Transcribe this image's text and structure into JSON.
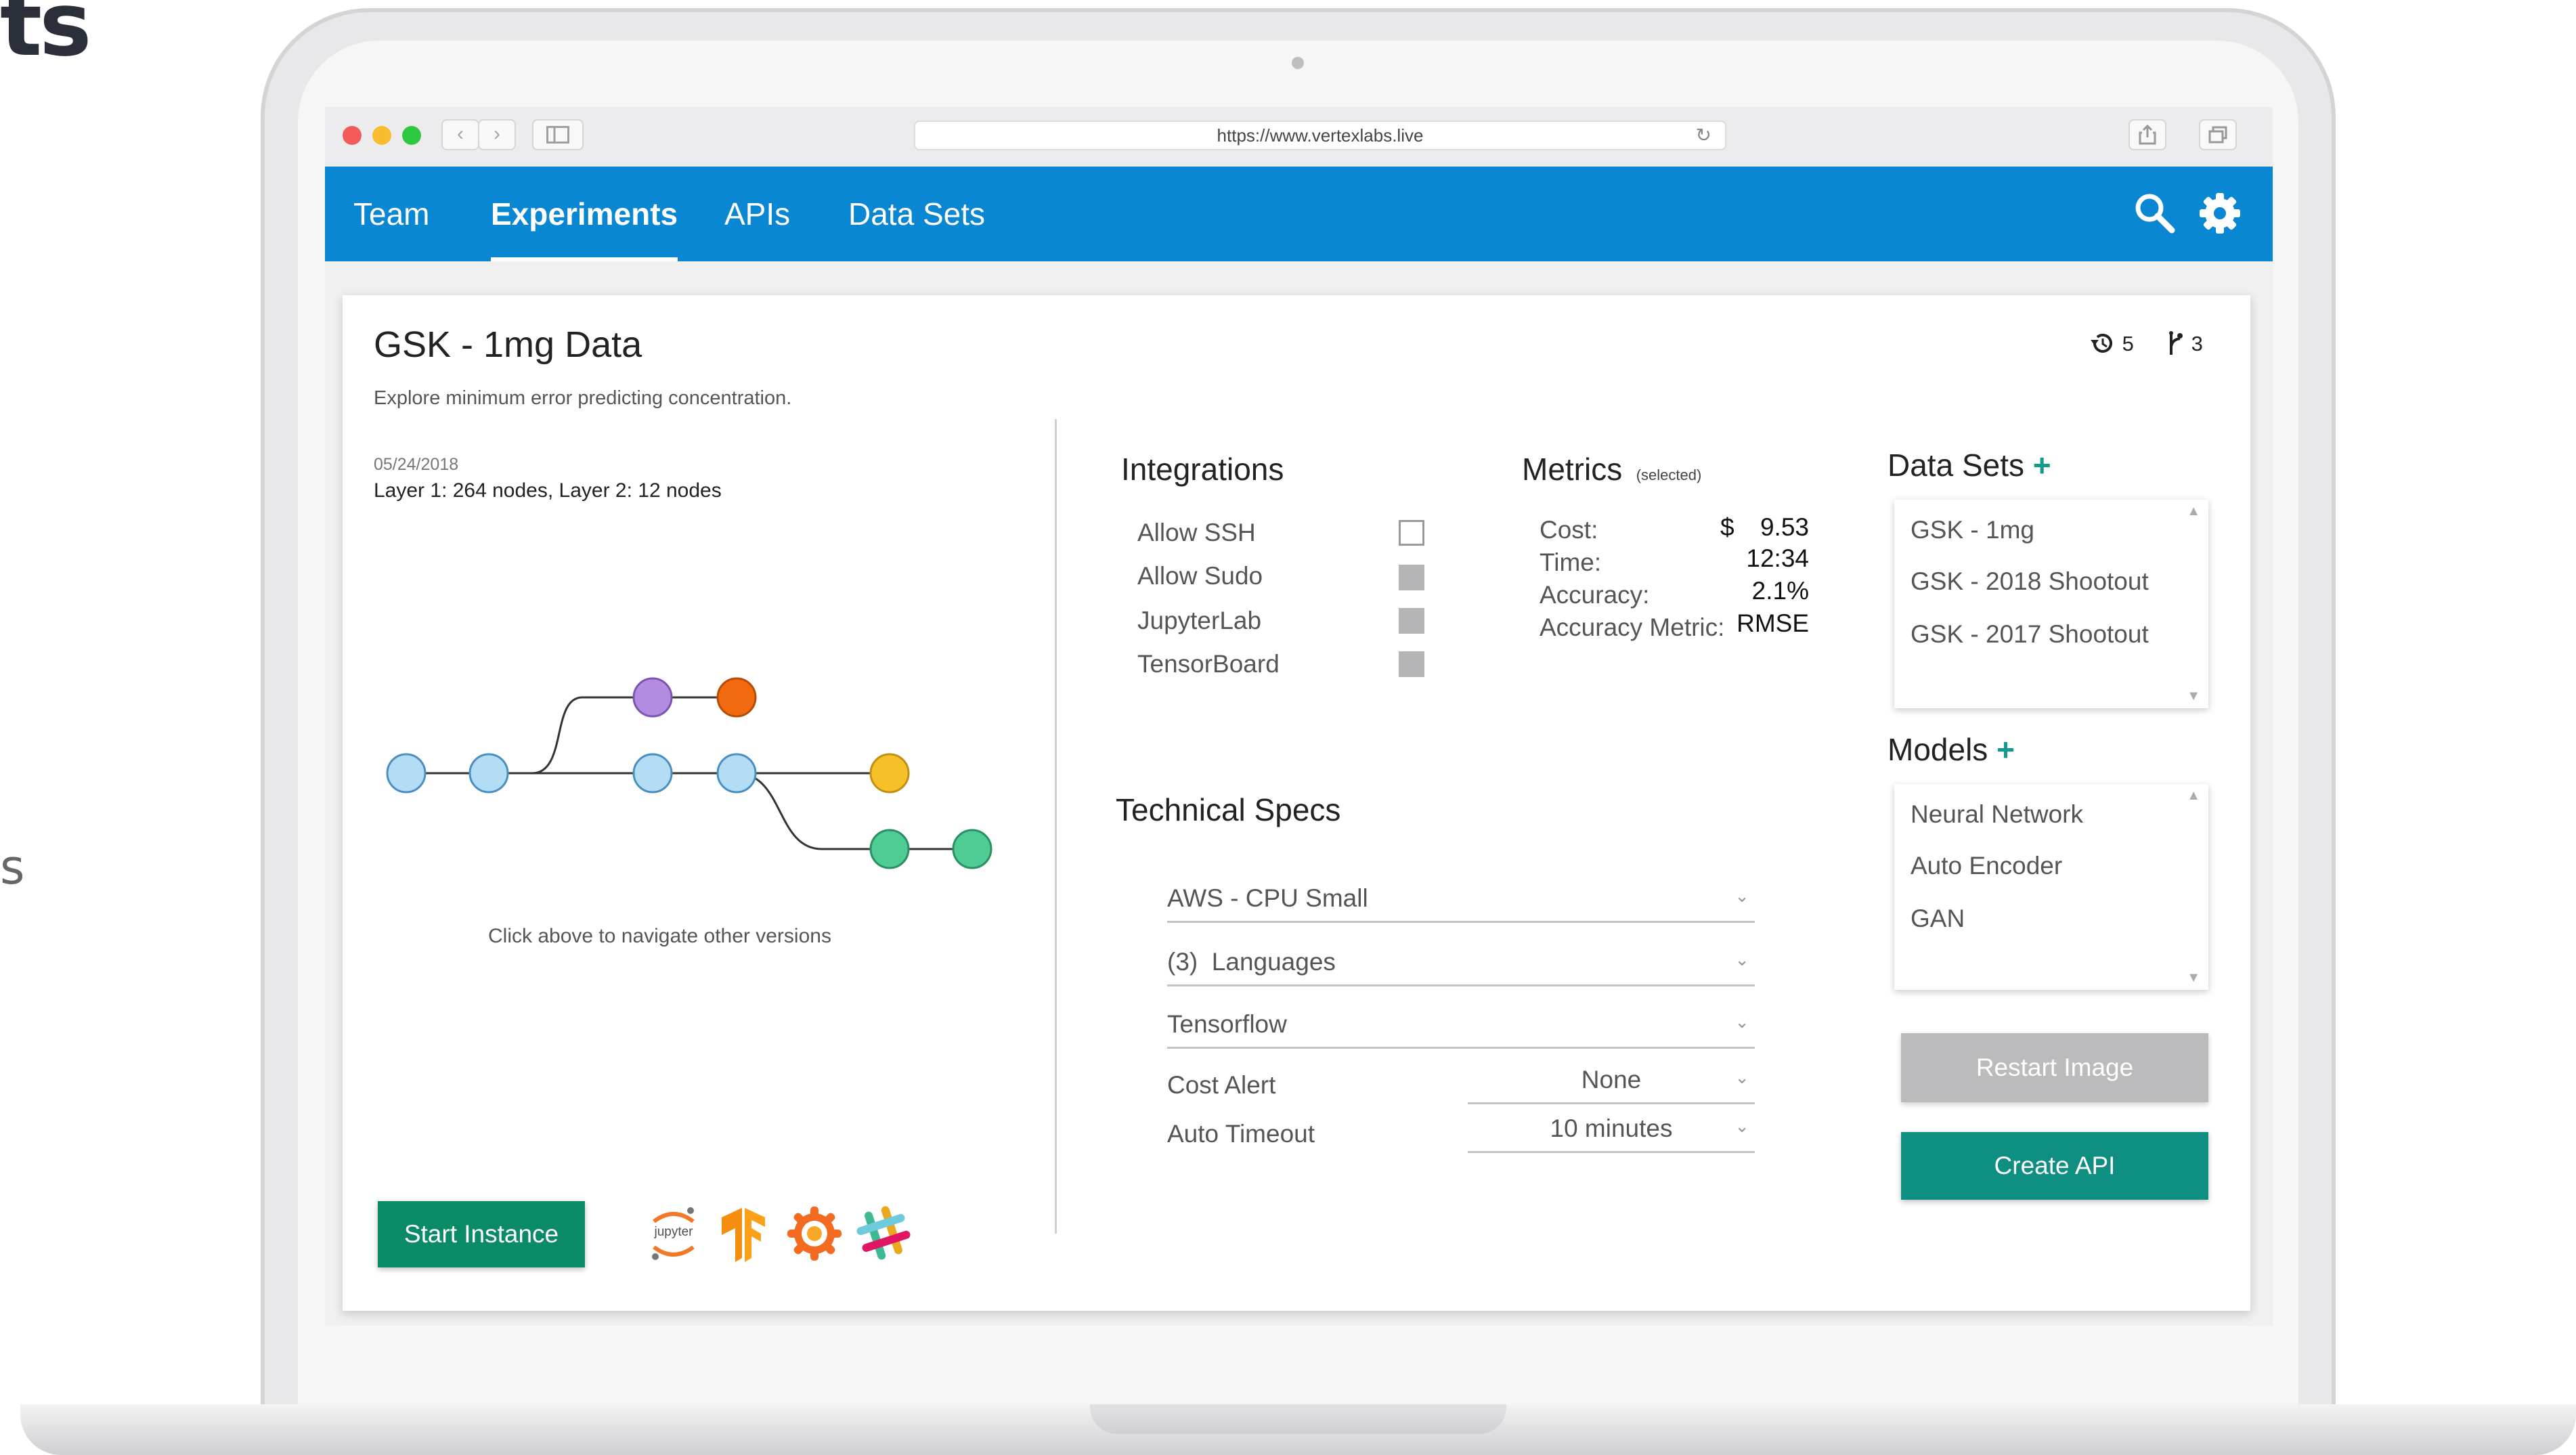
{
  "background": {
    "fragment_top": "ts",
    "fragment_mid": "s"
  },
  "browser": {
    "url": "https://www.vertexlabs.live",
    "back_glyph": "‹",
    "forward_glyph": "›"
  },
  "nav": {
    "tabs": [
      {
        "label": "Team",
        "active": false
      },
      {
        "label": "Experiments",
        "active": true
      },
      {
        "label": "APIs",
        "active": false
      },
      {
        "label": "Data Sets",
        "active": false
      }
    ],
    "icons": [
      "search-icon",
      "gear-icon"
    ]
  },
  "experiment": {
    "title": "GSK - 1mg Data",
    "subtitle": "Explore minimum error predicting concentration.",
    "date": "05/24/2018",
    "layers": "Layer 1: 264 nodes, Layer 2: 12 nodes",
    "history_count": "5",
    "branch_count": "3",
    "graph_hint": "Click above to navigate other versions"
  },
  "integrations": {
    "title": "Integrations",
    "items": [
      {
        "label": "Allow SSH",
        "checked": false
      },
      {
        "label": "Allow Sudo",
        "checked": true
      },
      {
        "label": "JupyterLab",
        "checked": true
      },
      {
        "label": "TensorBoard",
        "checked": true
      }
    ]
  },
  "metrics": {
    "title": "Metrics",
    "note": "(selected)",
    "rows": [
      {
        "label": "Cost:",
        "currency": "$",
        "value": "9.53"
      },
      {
        "label": "Time:",
        "value": "12:34"
      },
      {
        "label": "Accuracy:",
        "value": "2.1%"
      },
      {
        "label": "Accuracy Metric:",
        "value": "RMSE"
      }
    ]
  },
  "specs": {
    "title": "Technical Specs",
    "instance": "AWS - CPU Small",
    "languages_count": "(3)",
    "languages": "Languages",
    "framework": "Tensorflow",
    "cost_alert_label": "Cost Alert",
    "cost_alert_value": "None",
    "timeout_label": "Auto Timeout",
    "timeout_value": "10 minutes"
  },
  "datasets": {
    "title": "Data Sets",
    "plus": "+",
    "items": [
      "GSK - 1mg",
      "GSK - 2018 Shootout",
      "GSK - 2017 Shootout"
    ]
  },
  "models": {
    "title": "Models",
    "plus": "+",
    "items": [
      "Neural Network",
      "Auto Encoder",
      "GAN"
    ]
  },
  "buttons": {
    "restart": "Restart Image",
    "create_api": "Create API",
    "start": "Start Instance"
  },
  "tool_icons": {
    "jupyter_label": "jupyter",
    "icons": [
      "jupyter-icon",
      "tensorflow-icon",
      "grafana-icon",
      "slack-icon"
    ]
  },
  "colors": {
    "appbar": "#0a87d2",
    "teal": "#0e8f82",
    "green_button": "#0b8a68",
    "node_blue": "#b3dcf5",
    "node_purple": "#b38be0",
    "node_orange": "#f26a10",
    "node_yellow": "#f6c029",
    "node_green": "#4fcb94"
  }
}
